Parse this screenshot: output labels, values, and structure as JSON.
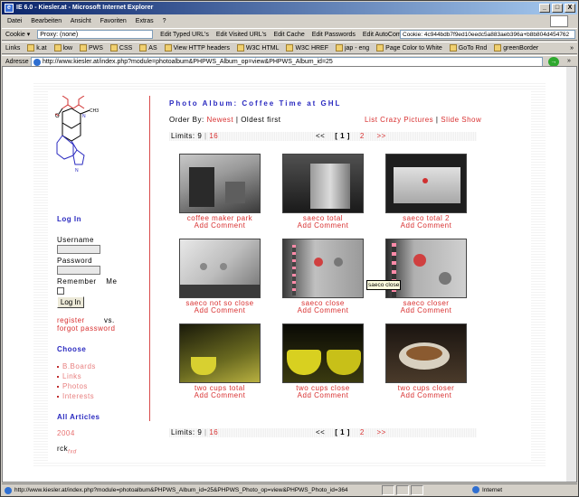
{
  "window": {
    "title": "IE 6.0 - Kiesler.at - Microsoft Internet Explorer",
    "buttons": [
      "_",
      "□",
      "X"
    ]
  },
  "menu": [
    "Datei",
    "Bearbeiten",
    "Ansicht",
    "Favoriten",
    "Extras",
    "?"
  ],
  "webdev_toolbar": {
    "cookie_menu": "Cookie ▾",
    "proxy_select": "Proxy: (none)",
    "items": [
      "Edit Typed URL's",
      "Edit Visited URL's",
      "Edit Cache",
      "Edit Passwords",
      "Edit AutoComplete"
    ],
    "cookie_value": "Cookie: 4c944bdb7f9ed10eedc5a883aeb396a+b8b804d454762"
  },
  "links_bar": {
    "label": "Links",
    "items": [
      "k.at",
      "low",
      "PWS",
      "CSS",
      "AS",
      "View HTTP headers",
      "W3C HTML",
      "W3C HREF",
      "jap - eng",
      "Page Color to White",
      "GoTo Rnd",
      "greenBorder"
    ],
    "overflow": "»"
  },
  "address_bar": {
    "label": "Adresse",
    "url": "http://www.kiesler.at/index.php?module=photoalbum&PHPWS_Album_op=view&PHPWS_Album_id=25",
    "go": "→",
    "links": "»"
  },
  "sidebar": {
    "login_heading": "Log In",
    "username_label": "Username",
    "password_label": "Password",
    "remember_label": "Remember Me",
    "login_button": "Log In",
    "register": "register",
    "vs": "vs.",
    "forgot": "forgot password",
    "choose_heading": "Choose",
    "choose_items": [
      "B.Boards",
      "Links",
      "Photos",
      "Interests"
    ],
    "articles_heading": "All Articles",
    "year": "2004",
    "sig_main": "rck",
    "sig_sub": "fxd"
  },
  "album": {
    "title": "Photo Album: Coffee Time at GHL",
    "order_by": "Order By:",
    "newest": "Newest",
    "sep": "|",
    "oldest": "Oldest",
    "first": "first",
    "list_link": "List Crazy Pictures",
    "slide_link": "Slide Show",
    "limits_label": "Limits: 9",
    "limits_sep": "|",
    "limits_alt": "16",
    "prev": "<<",
    "current_page": "[ 1 ]",
    "next_page": "2",
    "next": ">>",
    "add_comment": "Add Comment",
    "photos": [
      {
        "caption": "coffee maker park"
      },
      {
        "caption": "saeco total"
      },
      {
        "caption": "saeco total 2"
      },
      {
        "caption": "saeco not so close"
      },
      {
        "caption": "saeco close"
      },
      {
        "caption": "saeco closer"
      },
      {
        "caption": "two cups total"
      },
      {
        "caption": "two cups close"
      },
      {
        "caption": "two cups closer"
      }
    ],
    "tooltip": "saeco close"
  },
  "status": {
    "url": "http://www.kiesler.at/index.php?module=photoalbum&PHPWS_Album_id=25&PHPWS_Photo_op=view&PHPWS_Photo_id=364",
    "zone": "Internet"
  }
}
